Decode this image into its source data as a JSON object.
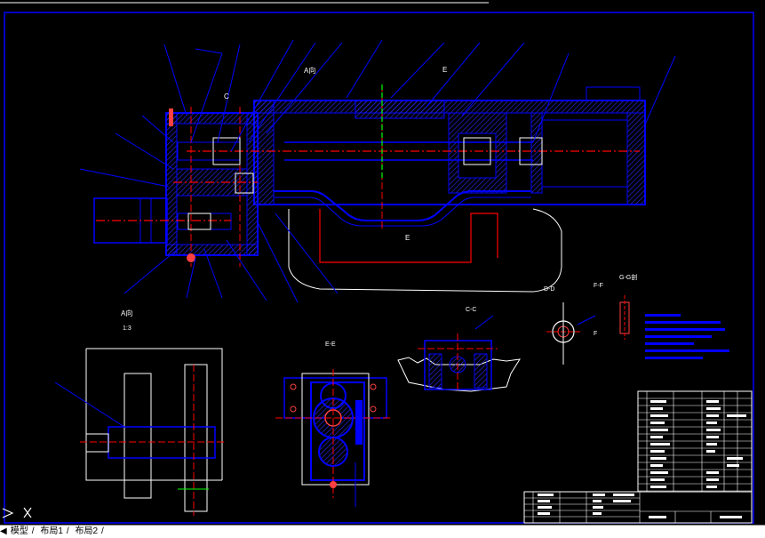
{
  "drawing": {
    "section_labels": {
      "view_a_top": "A向",
      "view_a": "A向",
      "scale": "1:3",
      "label_c": "C",
      "label_e_top": "E",
      "label_e_mid": "E",
      "section_c": "C-C",
      "section_d": "D-D",
      "section_e": "E-E",
      "section_f": "F-F",
      "section_g": "G-G剖",
      "arrow_f": "F"
    }
  },
  "layout_tabs": {
    "model": "模型",
    "layout1": "布局1",
    "layout2": "布局2"
  },
  "colors": {
    "background": "#000000",
    "outline": "#0000ff",
    "centerline": "#ff0000",
    "text": "#ffffff",
    "axis": "#00ff00"
  }
}
